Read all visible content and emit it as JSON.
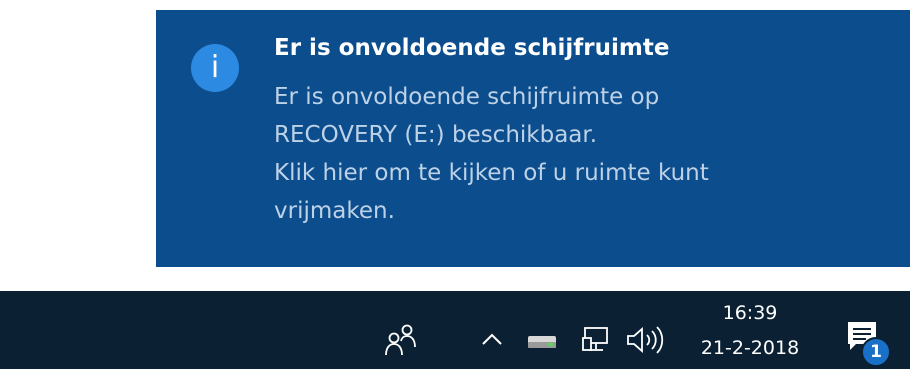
{
  "notification": {
    "icon": "info-icon",
    "icon_glyph": "i",
    "title": "Er is onvoldoende schijfruimte",
    "lines": [
      "Er is onvoldoende schijfruimte op",
      "RECOVERY (E:) beschikbaar.",
      "Klik hier om te kijken of u ruimte kunt",
      "vrijmaken."
    ],
    "colors": {
      "background": "#0c4d8d",
      "title": "#ffffff",
      "body": "#bdd2e7",
      "icon": "#2d8ae3"
    }
  },
  "taskbar": {
    "background": "#0b2133",
    "tray_icons": [
      "people-icon",
      "chevron-up-icon",
      "drive-icon",
      "network-icon",
      "volume-icon"
    ],
    "clock": {
      "time": "16:39",
      "date": "21-2-2018"
    },
    "action_center": {
      "icon": "action-center-icon",
      "badge": "1"
    }
  }
}
